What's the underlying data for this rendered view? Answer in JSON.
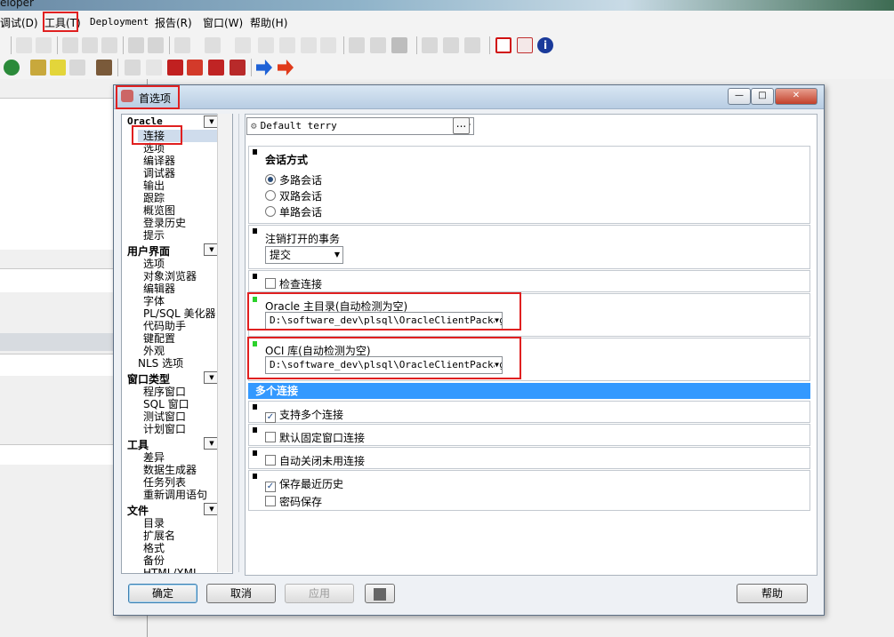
{
  "app": {
    "title_fragment": "eloper"
  },
  "menu": [
    {
      "label": "调试(D)"
    },
    {
      "label": "工具(T)"
    },
    {
      "label": "Deployment"
    },
    {
      "label": "报告(R)"
    },
    {
      "label": "窗口(W)"
    },
    {
      "label": "帮助(H)"
    }
  ],
  "dialog": {
    "title": "首选项",
    "profile_value": "Default terry",
    "profile_more": "...",
    "nav": [
      {
        "category": "Oracle",
        "items": [
          "连接",
          "选项",
          "编译器",
          "调试器",
          "输出",
          "跟踪",
          "概览图",
          "登录历史",
          "提示"
        ]
      },
      {
        "category": "用户界面",
        "items": [
          "选项",
          "对象浏览器",
          "编辑器",
          "字体",
          "PL/SQL 美化器",
          "代码助手",
          "键配置",
          "外观",
          "NLS 选项"
        ]
      },
      {
        "category": "窗口类型",
        "items": [
          "程序窗口",
          "SQL 窗口",
          "测试窗口",
          "计划窗口"
        ]
      },
      {
        "category": "工具",
        "items": [
          "差异",
          "数据生成器",
          "任务列表",
          "重新调用语句"
        ]
      },
      {
        "category": "文件",
        "items": [
          "目录",
          "扩展名",
          "格式",
          "备份",
          "HTML/XML"
        ]
      }
    ],
    "session": {
      "title": "会话方式",
      "options": [
        {
          "label": "多路会话",
          "selected": true
        },
        {
          "label": "双路会话",
          "selected": false
        },
        {
          "label": "单路会话",
          "selected": false
        }
      ]
    },
    "logoff": {
      "label": "注销打开的事务",
      "value": "提交"
    },
    "check_connection": {
      "label": "检查连接",
      "checked": false
    },
    "oracle_home": {
      "label": "Oracle 主目录(自动检测为空)",
      "value": "D:\\software_dev\\plsql\\OracleClientPackage"
    },
    "oci_lib": {
      "label": "OCI 库(自动检测为空)",
      "value": "D:\\software_dev\\plsql\\OracleClientPackage"
    },
    "multi_band": "多个连接",
    "multi": [
      {
        "label": "支持多个连接",
        "checked": true
      },
      {
        "label": "默认固定窗口连接",
        "checked": false
      },
      {
        "label": "自动关闭未用连接",
        "checked": false
      }
    ],
    "history": [
      {
        "label": "保存最近历史",
        "checked": true
      },
      {
        "label": "密码保存",
        "checked": false
      }
    ],
    "buttons": {
      "ok": "确定",
      "cancel": "取消",
      "apply": "应用",
      "help": "帮助"
    }
  },
  "colors": {
    "highlight_band": "#3399ff",
    "annotation_red": "#e02020",
    "marker_green": "#2bd12b"
  }
}
